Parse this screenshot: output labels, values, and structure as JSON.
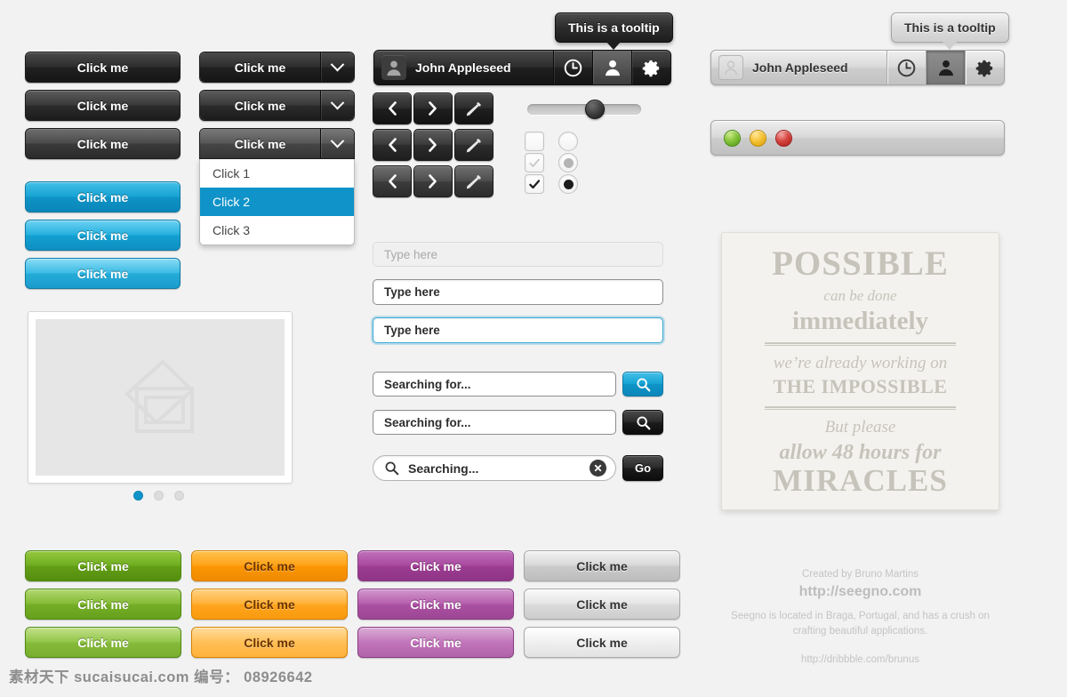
{
  "buttons_dark": [
    {
      "label": "Click me",
      "state": "normal"
    },
    {
      "label": "Click me",
      "state": "hover"
    },
    {
      "label": "Click me",
      "state": "pressed"
    }
  ],
  "buttons_blue": [
    {
      "label": "Click me",
      "state": "normal"
    },
    {
      "label": "Click me",
      "state": "hover"
    },
    {
      "label": "Click me",
      "state": "pressed"
    }
  ],
  "dropdowns": [
    {
      "label": "Click me",
      "state": "normal",
      "icon": "chevron-down-icon"
    },
    {
      "label": "Click me",
      "state": "hover",
      "icon": "chevron-down-icon"
    },
    {
      "label": "Click me",
      "state": "pressed",
      "icon": "chevron-down-icon"
    }
  ],
  "dropdown_menu": {
    "items": [
      {
        "label": "Click 1",
        "selected": false
      },
      {
        "label": "Click 2",
        "selected": true
      },
      {
        "label": "Click 3",
        "selected": false
      }
    ],
    "highlight_color": "#0f93c8"
  },
  "toolbar_dark": {
    "user_name": "John Appleseed",
    "avatar_icon": "user-avatar-icon",
    "buttons": [
      {
        "icon": "clock-icon",
        "active": false
      },
      {
        "icon": "user-icon",
        "active": true
      },
      {
        "icon": "gear-icon",
        "active": false
      }
    ],
    "tooltip": "This is a tooltip"
  },
  "toolbar_light": {
    "user_name": "John Appleseed",
    "avatar_icon": "user-avatar-icon",
    "buttons": [
      {
        "icon": "clock-icon",
        "active": false
      },
      {
        "icon": "user-icon",
        "active": true
      },
      {
        "icon": "gear-icon",
        "active": false
      }
    ],
    "tooltip": "This is a tooltip"
  },
  "icon_buttons": [
    {
      "icon": "chevron-left-icon",
      "state": "normal"
    },
    {
      "icon": "chevron-right-icon",
      "state": "normal"
    },
    {
      "icon": "pencil-icon",
      "state": "normal"
    },
    {
      "icon": "chevron-left-icon",
      "state": "hover"
    },
    {
      "icon": "chevron-right-icon",
      "state": "hover"
    },
    {
      "icon": "pencil-icon",
      "state": "hover"
    },
    {
      "icon": "chevron-left-icon",
      "state": "pressed"
    },
    {
      "icon": "chevron-right-icon",
      "state": "pressed"
    },
    {
      "icon": "pencil-icon",
      "state": "pressed"
    }
  ],
  "slider": {
    "value_percent": 57
  },
  "checkboxes": [
    {
      "state": "unchecked"
    },
    {
      "state": "checked-disabled"
    },
    {
      "state": "checked"
    }
  ],
  "radios": [
    {
      "state": "unselected"
    },
    {
      "state": "selected-disabled"
    },
    {
      "state": "selected"
    }
  ],
  "text_inputs": [
    {
      "value": "Type here",
      "state": "placeholder"
    },
    {
      "value": "Type here",
      "state": "normal"
    },
    {
      "value": "Type here",
      "state": "focus"
    }
  ],
  "search_rows": [
    {
      "value": "Searching for...",
      "button_icon": "search-icon",
      "button_style": "blue"
    },
    {
      "value": "Searching for...",
      "button_icon": "search-icon",
      "button_style": "black"
    }
  ],
  "search_pill": {
    "value": "Searching...",
    "leading_icon": "search-icon",
    "clear_icon": "clear-circle-icon",
    "go_label": "Go"
  },
  "image_placeholder": {
    "icon": "photos-placeholder-icon",
    "pagination": [
      {
        "active": true
      },
      {
        "active": false
      },
      {
        "active": false
      }
    ]
  },
  "poster": {
    "line1": "POSSIBLE",
    "line2": "can be done",
    "line3": "immediately",
    "line4": "we’re already working on",
    "line5": "THE IMPOSSIBLE",
    "line6": "But please",
    "line7": "allow 48 hours for",
    "line8": "MIRACLES"
  },
  "window_bar": {
    "lights": [
      {
        "name": "minimize-light",
        "color": "#86c53b"
      },
      {
        "name": "maximize-light",
        "color": "#f6c338"
      },
      {
        "name": "close-light",
        "color": "#d6453f"
      }
    ]
  },
  "color_buttons": {
    "green": [
      {
        "label": "Click me",
        "state": "normal"
      },
      {
        "label": "Click me",
        "state": "hover"
      },
      {
        "label": "Click me",
        "state": "pressed"
      }
    ],
    "orange": [
      {
        "label": "Click me",
        "state": "normal"
      },
      {
        "label": "Click me",
        "state": "hover"
      },
      {
        "label": "Click me",
        "state": "pressed"
      }
    ],
    "purple": [
      {
        "label": "Click me",
        "state": "normal"
      },
      {
        "label": "Click me",
        "state": "hover"
      },
      {
        "label": "Click me",
        "state": "pressed"
      }
    ],
    "silver": [
      {
        "label": "Click me",
        "state": "normal"
      },
      {
        "label": "Click me",
        "state": "hover"
      },
      {
        "label": "Click me",
        "state": "pressed"
      }
    ]
  },
  "credits": {
    "created_by": "Created by Bruno Martins",
    "site": "http://seegno.com",
    "about_line1": "Seegno is located in Braga, Portugal, and has a crush on",
    "about_line2": "crafting beautiful applications.",
    "dribbble": "http://dribbble.com/brunus"
  },
  "watermark": {
    "text": "素材天下 sucaisucai.com  编号： 08926642"
  }
}
